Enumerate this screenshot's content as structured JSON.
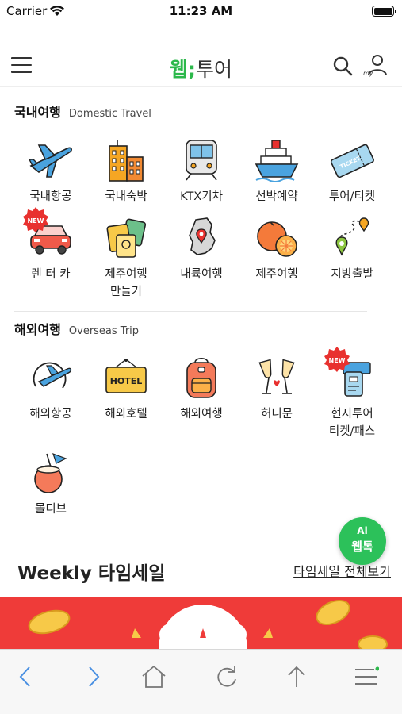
{
  "status": {
    "carrier": "Carrier",
    "time": "11:23 AM"
  },
  "header": {
    "logo_green": "웹",
    "logo_dot": ";",
    "logo_dark": "투어"
  },
  "domestic": {
    "title_ko": "국내여행",
    "title_en": "Domestic Travel",
    "items": [
      {
        "label": "국내항공",
        "icon": "airplane-icon"
      },
      {
        "label": "국내숙박",
        "icon": "hotel-building-icon"
      },
      {
        "label": "KTX기차",
        "icon": "train-icon"
      },
      {
        "label": "선박예약",
        "icon": "ship-icon"
      },
      {
        "label": "투어/티켓",
        "icon": "ticket-icon"
      },
      {
        "label": "렌 터 카",
        "icon": "car-icon",
        "badge": "NEW"
      },
      {
        "label": "제주여행\n만들기",
        "icon": "jeju-cards-icon"
      },
      {
        "label": "내륙여행",
        "icon": "korea-map-icon"
      },
      {
        "label": "제주여행",
        "icon": "orange-icon"
      },
      {
        "label": "지방출발",
        "icon": "route-icon"
      }
    ]
  },
  "overseas": {
    "title_ko": "해외여행",
    "title_en": "Overseas Trip",
    "items": [
      {
        "label": "해외항공",
        "icon": "globe-plane-icon"
      },
      {
        "label": "해외호텔",
        "icon": "hotel-sign-icon",
        "sign": "HOTEL"
      },
      {
        "label": "해외여행",
        "icon": "backpack-icon"
      },
      {
        "label": "허니문",
        "icon": "champagne-icon"
      },
      {
        "label": "현지투어\n티켓/패스",
        "icon": "pass-ticket-icon",
        "badge": "NEW"
      },
      {
        "label": "몰디브",
        "icon": "coconut-drink-icon"
      }
    ]
  },
  "weekly": {
    "title": "Weekly 타임세일",
    "link": "타임세일 전체보기"
  },
  "webtalk": {
    "ai": "Ai",
    "label": "웹톡"
  },
  "colors": {
    "brand_green": "#2cb84b",
    "badge_red": "#e8312f",
    "banner_red": "#ef3b39",
    "toolbar_blue": "#4a90e2"
  }
}
